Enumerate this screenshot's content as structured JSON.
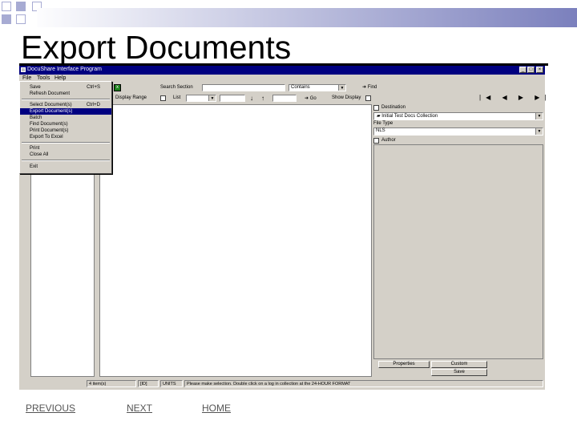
{
  "slide": {
    "title": "Export Documents",
    "nav": {
      "previous": "PREVIOUS",
      "next": "NEXT",
      "home": "HOME"
    }
  },
  "window": {
    "title": "DocuShare Interface Program",
    "controls": {
      "minimize": "_",
      "maximize": "□",
      "close": "×"
    }
  },
  "menubar": {
    "file": "File",
    "tools": "Tools",
    "help": "Help"
  },
  "file_menu": {
    "items": [
      {
        "label": "Save",
        "shortcut": "Ctrl+S"
      },
      {
        "label": "Refresh Document",
        "shortcut": ""
      },
      {
        "label": "Select Document(s)",
        "shortcut": "Ctrl+D"
      },
      {
        "label": "Export Document(s)",
        "shortcut": "",
        "selected": true
      },
      {
        "label": "Batch",
        "shortcut": ""
      },
      {
        "label": "Find Document(s)",
        "shortcut": ""
      },
      {
        "label": "Print Document(s)",
        "shortcut": ""
      },
      {
        "label": "Export To Excel",
        "shortcut": ""
      },
      {
        "label": "Print",
        "shortcut": ""
      },
      {
        "label": "Close All",
        "shortcut": ""
      },
      {
        "label": "Exit",
        "shortcut": ""
      }
    ]
  },
  "toolbar": {
    "search_section_label": "Search Section",
    "search_value": "",
    "operator_value": "Contains",
    "find_label": "Find",
    "display_range_label": "Display Range",
    "list_label": "List",
    "go_label": "Go",
    "show_display_label": "Show Display"
  },
  "right_panel": {
    "destination_label": "Destination",
    "collection_value": "Initial Test Docs Collection",
    "file_type_label": "File Type",
    "file_type_value": "NLS",
    "author_label": "Author",
    "tabs": {
      "properties": "Properties",
      "custom": "Custom"
    },
    "save_button": "Save"
  },
  "statusbar": {
    "docs_count": "4 item(s)",
    "id_label": "[ID]",
    "units": "UNITS",
    "message": "Please make selection. Double click on a log in collection at the 24-HOUR FORMAT"
  },
  "colors": {
    "titlebar": "#000080",
    "window_face": "#d4d0c8",
    "accent_squares": "#a7abd3"
  }
}
